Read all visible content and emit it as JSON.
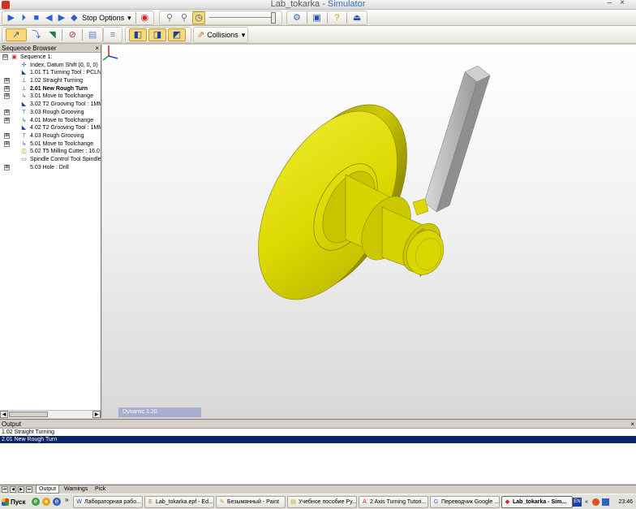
{
  "window": {
    "title_app": "Lab_tokarka - ",
    "title_mode": "Simulator",
    "minimize": "–",
    "close": "×"
  },
  "toolbar1": {
    "stop_options_label": "Stop Options",
    "dropdown_arrow": "▾"
  },
  "toolbar2": {
    "collisions_label": "Collisions"
  },
  "sequence_browser": {
    "title": "Sequence Browser",
    "close": "×",
    "items": [
      {
        "label": "Sequence 1:",
        "indent": 0,
        "expander": "⊟",
        "icon": "sequence-icon"
      },
      {
        "label": "Index, Datum Shift (0, 0, 0)",
        "indent": 1,
        "expander": "",
        "icon": "index-icon"
      },
      {
        "label": "1.01 T1 Turning Tool : PCLN",
        "indent": 1,
        "expander": "",
        "icon": "tool-icon"
      },
      {
        "label": "1.02 Straight Turning",
        "indent": 1,
        "expander": "⊞",
        "icon": "turning-icon"
      },
      {
        "label": "2.01 New Rough Turn",
        "indent": 1,
        "expander": "⊞",
        "icon": "turning-icon",
        "bold": true
      },
      {
        "label": "3.01 Move to Toolchange",
        "indent": 1,
        "expander": "⊞",
        "icon": "move-icon"
      },
      {
        "label": "3.02 T2 Grooving Tool : 1MM",
        "indent": 1,
        "expander": "",
        "icon": "tool-icon"
      },
      {
        "label": "3.03 Rough Grooving",
        "indent": 1,
        "expander": "⊞",
        "icon": "grooving-icon"
      },
      {
        "label": "4.01 Move to Toolchange",
        "indent": 1,
        "expander": "⊞",
        "icon": "move-icon"
      },
      {
        "label": "4.02 T2 Grooving Tool : 1MM",
        "indent": 1,
        "expander": "",
        "icon": "tool-icon"
      },
      {
        "label": "4.03 Rough Grooving",
        "indent": 1,
        "expander": "⊞",
        "icon": "grooving-icon"
      },
      {
        "label": "5.01 Move to Toolchange",
        "indent": 1,
        "expander": "⊞",
        "icon": "move-icon"
      },
      {
        "label": "5.02 T5 Milling Cutter : 16.0 M",
        "indent": 1,
        "expander": "",
        "icon": "mill-icon"
      },
      {
        "label": "Spindle Control Tool Spindle (",
        "indent": 1,
        "expander": "",
        "icon": "spindle-icon"
      },
      {
        "label": "5.03 Hole : Drill",
        "indent": 1,
        "expander": "⊞",
        "icon": ""
      }
    ]
  },
  "viewport": {
    "view_label": "Dynamic 1.20"
  },
  "output": {
    "title": "Output",
    "close": "×",
    "lines": [
      {
        "text": "1.02 Straight Turning",
        "selected": false
      },
      {
        "text": "2.01 New Rough Turn",
        "selected": true
      }
    ]
  },
  "tabs": [
    {
      "label": "Output",
      "active": true
    },
    {
      "label": "Warnings",
      "active": false
    },
    {
      "label": "Pick",
      "active": false
    }
  ],
  "taskbar": {
    "start_label": "Пуск",
    "more": "»",
    "tasks": [
      {
        "label": "Лабораторная рабо...",
        "active": false
      },
      {
        "label": "Lab_tokarka.epf - Ed...",
        "active": false
      },
      {
        "label": "Безымянный - Paint",
        "active": false
      },
      {
        "label": "Учебное пособие Ру...",
        "active": false
      },
      {
        "label": "2 Axis Turning Tutori...",
        "active": false
      },
      {
        "label": "Переводчик Google ...",
        "active": false
      },
      {
        "label": "Lab_tokarka - Sim...",
        "active": true
      }
    ],
    "lang": "EN",
    "tray_more": "«",
    "clock": "23:46"
  },
  "colors": {
    "part": "#d8d400",
    "part_shadow": "#8a8600",
    "tool": "#b8b8b8",
    "selection": "#0a246a"
  }
}
